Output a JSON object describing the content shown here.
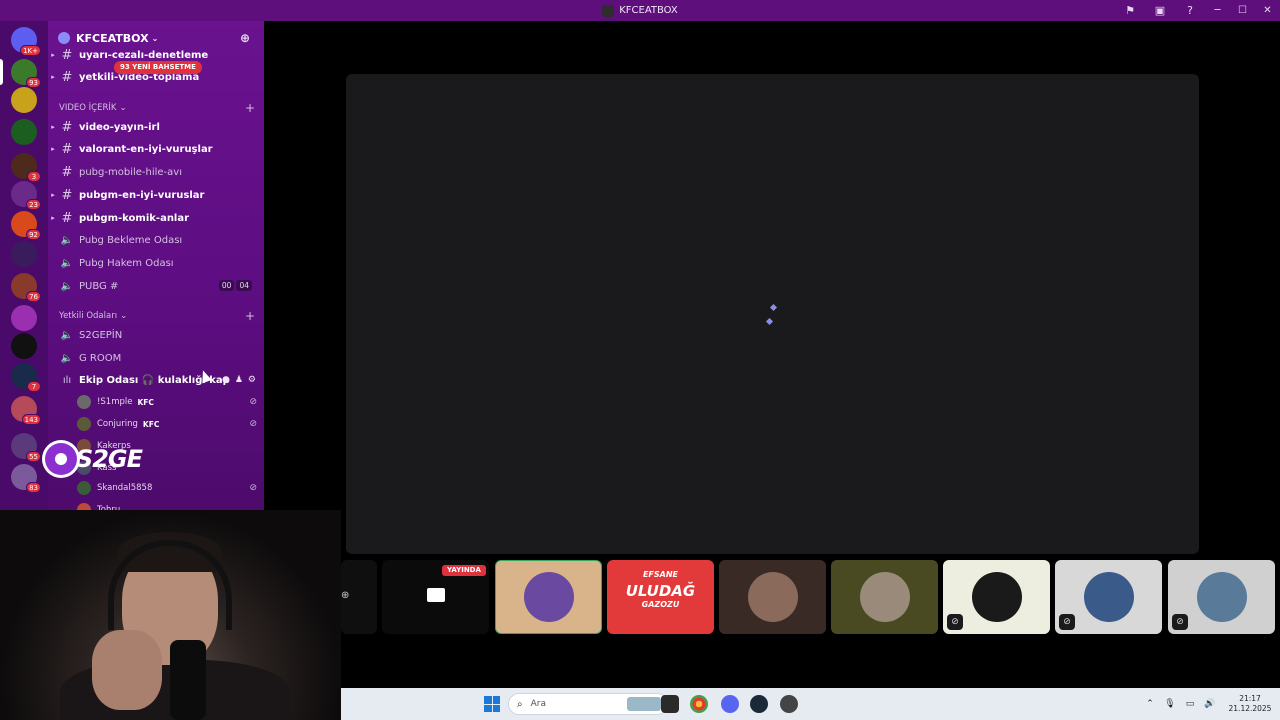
{
  "window": {
    "title": "KFCEATBOX"
  },
  "server": {
    "name": "KFCEATBOX",
    "mention_tag": "93 YENİ BAHSETME"
  },
  "rail": {
    "home_badge": "1K+",
    "servers": [
      {
        "name": "server-1",
        "badge": "93",
        "color": "#3b7a2a"
      },
      {
        "name": "server-2",
        "badge": "",
        "color": "#c9a21c"
      },
      {
        "name": "server-3",
        "badge": "",
        "color": "#1b5e20"
      },
      {
        "name": "server-4",
        "badge": "3",
        "color": "#4d2a1c"
      },
      {
        "name": "server-5",
        "badge": "23",
        "color": "#6b2a8a"
      },
      {
        "name": "server-6",
        "badge": "92",
        "color": "#d84a1b"
      },
      {
        "name": "server-7",
        "badge": "",
        "color": "#3a1c5c"
      },
      {
        "name": "server-8",
        "badge": "76",
        "color": "#8a3a2a"
      },
      {
        "name": "server-9",
        "badge": "",
        "color": "#9a2fb0"
      },
      {
        "name": "server-10",
        "badge": "",
        "color": "#111111"
      },
      {
        "name": "server-11",
        "badge": "7",
        "color": "#1a2a4a"
      },
      {
        "name": "server-12",
        "badge": "143",
        "color": "#b44a5a"
      },
      {
        "name": "server-13",
        "badge": "55",
        "color": "#5a3a7a"
      },
      {
        "name": "server-14",
        "badge": "83",
        "color": "#7a5a9a"
      }
    ]
  },
  "channels_top": [
    {
      "label": "uyarı-cezalı-denetleme",
      "bold": true
    },
    {
      "label": "yetkili-video-toplama",
      "bold": true
    }
  ],
  "category_video": "VIDEO İÇERİK",
  "channels_video": [
    {
      "label": "video-yayın-irl",
      "type": "text",
      "bold": true
    },
    {
      "label": "valorant-en-iyi-vuruşlar",
      "type": "text",
      "bold": true
    },
    {
      "label": "pubg-mobile-hile-avı",
      "type": "text",
      "bold": false
    },
    {
      "label": "pubgm-en-iyi-vuruslar",
      "type": "text",
      "bold": true
    },
    {
      "label": "pubgm-komik-anlar",
      "type": "text",
      "bold": true
    },
    {
      "label": "Pubg Bekleme Odası",
      "type": "voice",
      "bold": false
    },
    {
      "label": "Pubg Hakem Odası",
      "type": "voice",
      "bold": false
    },
    {
      "label": "PUBG #",
      "type": "voice",
      "bold": false
    }
  ],
  "pubg_count": {
    "a": "00",
    "b": "04"
  },
  "category_staff": "Yetkili Odaları",
  "channels_staff": [
    {
      "label": "S2GEPİN",
      "type": "voice"
    },
    {
      "label": "G ROOM",
      "type": "voice"
    },
    {
      "label": "Ekip Odası 🎧 kulaklığı kap",
      "type": "voice-active"
    }
  ],
  "users": [
    {
      "name": "!S1mple",
      "tag": "KFC",
      "color": "#6a6a6a"
    },
    {
      "name": "Conjuring",
      "tag": "KFC",
      "color": "#5a5a3a"
    },
    {
      "name": "Kakerps",
      "tag": "",
      "color": "#7a4a3a"
    },
    {
      "name": "Kass",
      "tag": "",
      "color": "#4a4a6a"
    },
    {
      "name": "Skandal5858",
      "tag": "",
      "color": "#3a5a3a"
    },
    {
      "name": "Tohru",
      "tag": "",
      "color": "#c04a3a"
    }
  ],
  "stage": {
    "live_label": "YAYINDA"
  },
  "tiles": [
    {
      "name": "tile-stream",
      "bg": "#0b0b0b",
      "face": ""
    },
    {
      "name": "tile-user-1",
      "bg": "#d9b48a",
      "face": "#6a4aa0"
    },
    {
      "name": "tile-user-2",
      "bg": "#e23a3a",
      "face": ""
    },
    {
      "name": "tile-user-3",
      "bg": "#3a2a26",
      "face": "#8a6a5a"
    },
    {
      "name": "tile-user-4",
      "bg": "#4a4a22",
      "face": "#9a8a7a"
    },
    {
      "name": "tile-user-5",
      "bg": "#eeeee0",
      "face": "#1a1a1a"
    },
    {
      "name": "tile-user-6",
      "bg": "#d8d8d8",
      "face": "#3a5a8a"
    },
    {
      "name": "tile-user-7",
      "bg": "#d0d0d0",
      "face": "#5a7a9a"
    }
  ],
  "tile_overlay_text": {
    "uludag_1": "EFSANE",
    "uludag_2": "ULUDAĞ",
    "uludag_3": "GAZOZU"
  },
  "overlay_logo": "S2GE",
  "taskbar": {
    "search_placeholder": "Ara",
    "time": "21:17",
    "date": "21.12.2025"
  }
}
